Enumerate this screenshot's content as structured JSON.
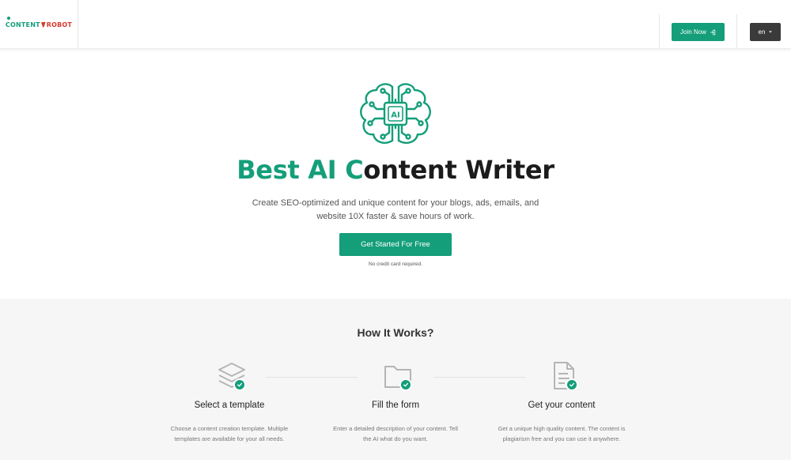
{
  "header": {
    "logo_text_1": "CONTENT",
    "logo_text_2": "ROBOT",
    "join_label": "Join Now",
    "lang_label": "en"
  },
  "hero": {
    "title_accent_1": "Best AI C",
    "title_rest": "ontent Writer",
    "subtitle_line1": "Create SEO-optimized and unique content for your blogs, ads, emails, and",
    "subtitle_line2": "website 10X faster & save hours of work.",
    "cta_label": "Get Started For Free",
    "cta_note": "No credit card required.",
    "chip_label": "AI"
  },
  "how": {
    "title": "How It Works?",
    "steps": [
      {
        "title": "Select a template",
        "desc_line1": "Choose a content creation template. Multiple",
        "desc_line2": "templates are available for your all needs.",
        "icon": "layers-icon"
      },
      {
        "title": "Fill the form",
        "desc_line1": "Enter a detailed description of your content. Tell",
        "desc_line2": "the AI what do you want.",
        "icon": "folder-icon"
      },
      {
        "title": "Get your content",
        "desc_line1": "Get a unique high quality content. The content is",
        "desc_line2": "plagiarism free and you can use it anywhere.",
        "icon": "document-icon"
      }
    ]
  },
  "colors": {
    "brand_green": "#149e7a",
    "brand_red": "#d83a2c",
    "dark_button": "#3a3a3a",
    "section_bg": "#f6f6f6"
  }
}
